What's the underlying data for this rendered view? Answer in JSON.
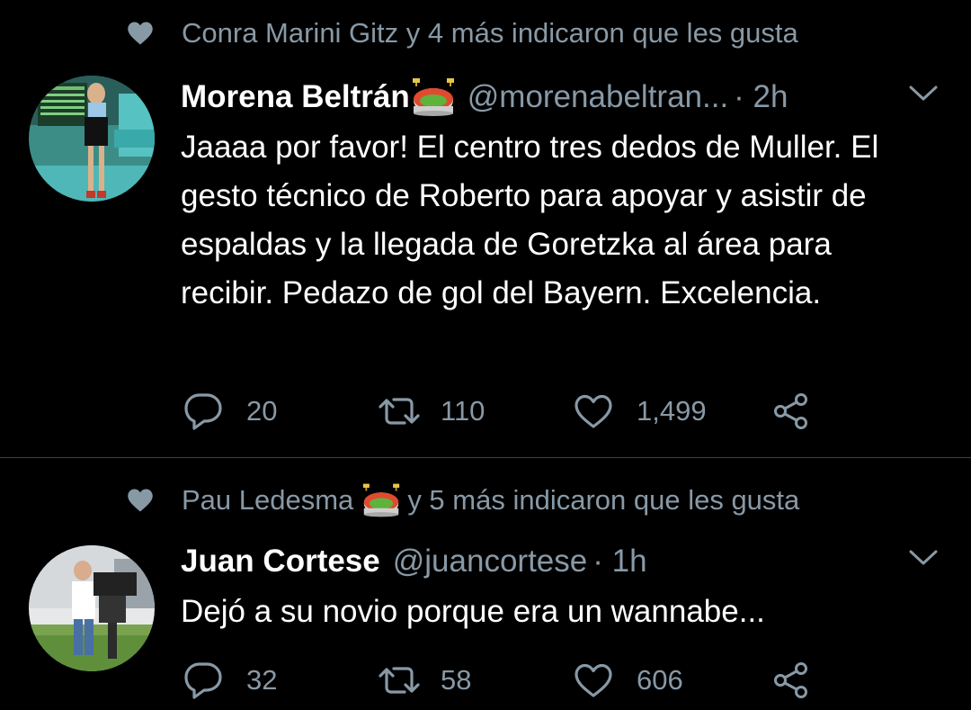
{
  "colors": {
    "background": "#000000",
    "text_primary": "#ffffff",
    "text_secondary": "#8899a6",
    "divider": "#38444d"
  },
  "tweets": [
    {
      "social_context": "Conra Marini Gitz y 4 más indicaron que les gusta",
      "author_name": "Morena Beltrán",
      "author_handle": "@morenabeltran...",
      "time": "· 2h",
      "text": "Jaaaa por favor! El centro tres dedos de Muller. El gesto técnico de Roberto para apoyar y asistir de espaldas y la llegada de Goretzka al área para recibir. Pedazo de gol del Bayern. Excelencia.",
      "replies": "20",
      "retweets": "110",
      "likes": "1,499",
      "icons": [
        "heart-icon",
        "stadium-emoji",
        "chevron-down-icon",
        "reply-icon",
        "retweet-icon",
        "like-icon",
        "share-icon"
      ]
    },
    {
      "social_context_before": "Pau Ledesma",
      "social_context_after": "y 5 más indicaron que les gusta",
      "author_name": "Juan Cortese",
      "author_handle": "@juancortese",
      "time": "· 1h",
      "text": "Dejó a su novio porque era un wannabe...",
      "replies": "32",
      "retweets": "58",
      "likes": "606",
      "icons": [
        "heart-icon",
        "stadium-emoji",
        "chevron-down-icon",
        "reply-icon",
        "retweet-icon",
        "like-icon",
        "share-icon"
      ]
    }
  ]
}
